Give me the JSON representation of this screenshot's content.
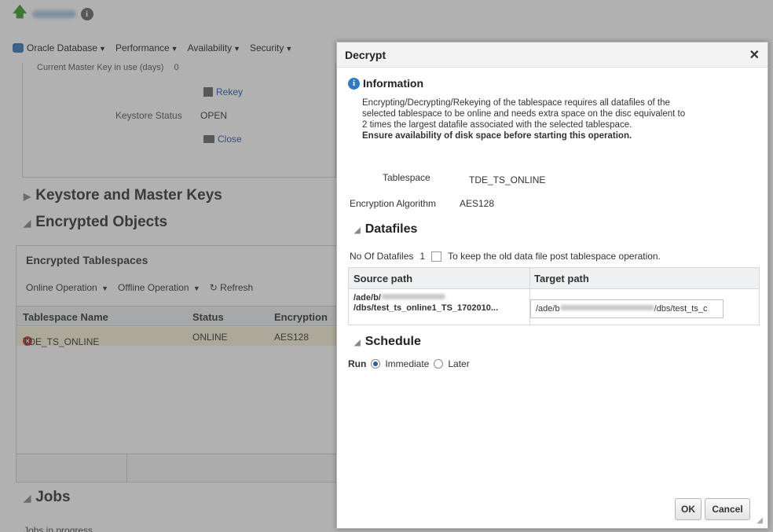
{
  "page": {
    "menu": [
      {
        "label": "Oracle Database"
      },
      {
        "label": "Performance"
      },
      {
        "label": "Availability"
      },
      {
        "label": "Security"
      }
    ],
    "keystore_row_partial": "Current Master Key in use (days)",
    "keystore_row_partial_value": "0",
    "rekey_link": "Rekey",
    "keystore_status_label": "Keystore Status",
    "keystore_status_value": "OPEN",
    "close_link": "Close",
    "section_keystore": "Keystore and Master Keys",
    "section_encrypted": "Encrypted Objects",
    "enc_panel_title": "Encrypted Tablespaces",
    "toolbar": {
      "online": "Online Operation",
      "offline": "Offline Operation",
      "refresh": "Refresh"
    },
    "table_headers": [
      "Tablespace Name",
      "Status",
      "Encryption"
    ],
    "table_row": [
      "TDE_TS_ONLINE",
      "ONLINE",
      "AES128"
    ],
    "section_jobs": "Jobs",
    "jobs_sub": "Jobs in progress"
  },
  "dialog": {
    "title": "Decrypt",
    "info_heading": "Information",
    "info_lines": [
      "Encrypting/Decrypting/Rekeying of the tablespace requires all datafiles of the",
      "selected tablespace to be online and needs extra space on the disc equivalent to",
      "2 times the largest datafile associated with the selected tablespace."
    ],
    "info_bold": "Ensure availability of disk space before starting this operation.",
    "tablespace_label": "Tablespace",
    "tablespace_value": "TDE_TS_ONLINE",
    "algorithm_label": "Encryption Algorithm",
    "algorithm_value": "AES128",
    "datafiles_heading": "Datafiles",
    "no_of_datafiles_label": "No Of Datafiles",
    "no_of_datafiles_value": "1",
    "keep_old_label": "To keep the old data file post tablespace operation.",
    "keep_old_checked": false,
    "col_source": "Source path",
    "col_target": "Target path",
    "source_line1_prefix": "/ade/b/",
    "source_line2": "/dbs/test_ts_online1_TS_1702010...",
    "target_prefix": "/ade/b",
    "target_suffix": "/dbs/test_ts_c",
    "schedule_heading": "Schedule",
    "run_label": "Run",
    "run_options": [
      "Immediate",
      "Later"
    ],
    "run_selected": "Immediate",
    "ok_label": "OK",
    "cancel_label": "Cancel"
  }
}
